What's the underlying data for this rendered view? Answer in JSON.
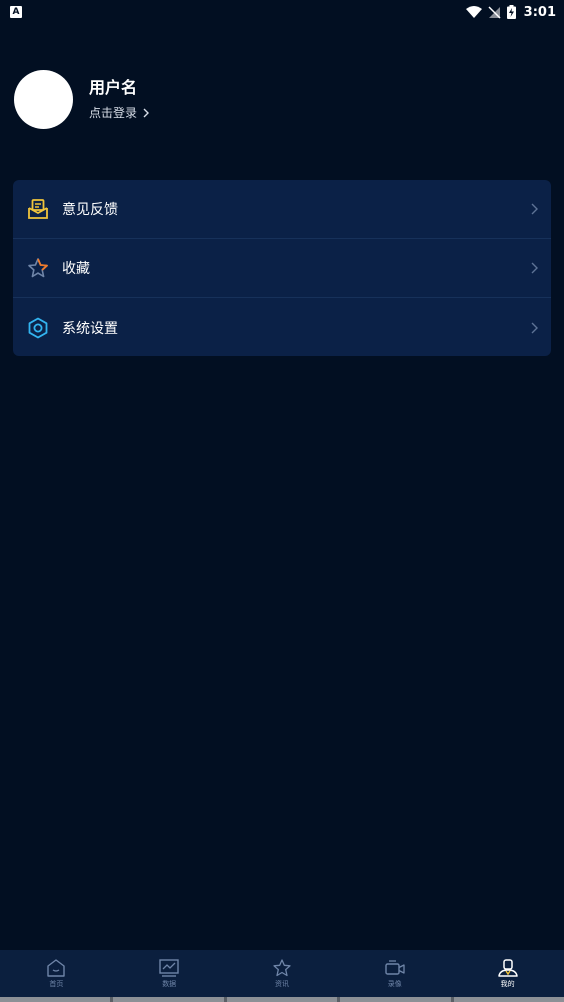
{
  "status_bar": {
    "time": "3:01",
    "left_icon_letter": "A"
  },
  "profile": {
    "username": "用户名",
    "login_prompt": "点击登录"
  },
  "menu": {
    "items": [
      {
        "label": "意见反馈",
        "icon": "feedback-mail-icon",
        "icon_color": "#f0c43c"
      },
      {
        "label": "收藏",
        "icon": "star-icon",
        "icon_color": "#f07a2a"
      },
      {
        "label": "系统设置",
        "icon": "settings-hex-icon",
        "icon_color": "#32b4f0"
      }
    ]
  },
  "tabs": [
    {
      "label": "首页",
      "icon": "home-icon",
      "active": false
    },
    {
      "label": "数据",
      "icon": "chart-icon",
      "active": false
    },
    {
      "label": "资讯",
      "icon": "star-outline-icon",
      "active": false
    },
    {
      "label": "录像",
      "icon": "video-icon",
      "active": false
    },
    {
      "label": "我的",
      "icon": "user-icon",
      "active": true
    }
  ],
  "colors": {
    "background": "#020f22",
    "card": "#0b2147",
    "tab_bar": "#0b1f3e",
    "tab_inactive": "#6f85a8",
    "tab_active": "#ffffff"
  }
}
